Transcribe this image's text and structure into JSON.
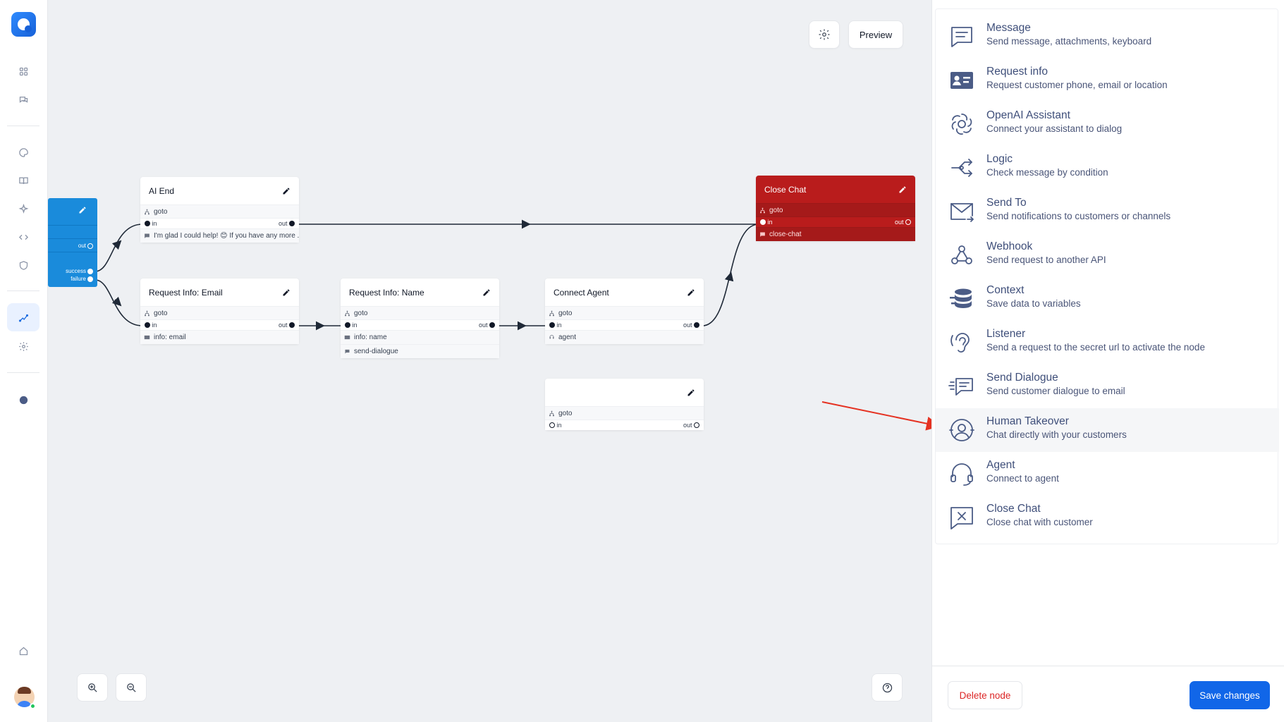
{
  "colors": {
    "accent": "#1166e8",
    "start_node": "#1a8bdb",
    "close_node": "#b91c1c",
    "arrow": "#e53222",
    "delete_text": "#dc2626"
  },
  "sidebar": {
    "icons": [
      "logo-icon",
      "dashboard-icon",
      "chats-icon",
      "palette-icon",
      "book-icon",
      "sparkles-icon",
      "code-icon",
      "shield-icon",
      "flow-icon",
      "gear-icon",
      "chat-bubble-icon",
      "home-icon"
    ],
    "active": "flow-icon"
  },
  "toolbar": {
    "preview_label": "Preview"
  },
  "nodes": {
    "start": {
      "out": "out",
      "success": "success",
      "failure": "failure"
    },
    "ai_end": {
      "title": "AI End",
      "goto": "goto",
      "in": "in",
      "out": "out",
      "detail": "I'm glad I could help! 😊 If you have any more ..."
    },
    "req_email": {
      "title": "Request Info: Email",
      "goto": "goto",
      "in": "in",
      "out": "out",
      "detail": "info: email"
    },
    "req_name": {
      "title": "Request Info: Name",
      "goto": "goto",
      "in": "in",
      "out": "out",
      "detail": "info: name",
      "detail2": "send-dialogue"
    },
    "connect_agent": {
      "title": "Connect Agent",
      "goto": "goto",
      "in": "in",
      "out": "out",
      "detail": "agent"
    },
    "empty_node": {
      "title": "",
      "goto": "goto",
      "in": "in",
      "out": "out"
    },
    "close_chat": {
      "title": "Close Chat",
      "goto": "goto",
      "in": "in",
      "out": "out",
      "detail": "close-chat"
    }
  },
  "panel": {
    "items": [
      {
        "title": "Message",
        "desc": "Send message, attachments, keyboard",
        "icon": "message-icon"
      },
      {
        "title": "Request info",
        "desc": "Request customer phone, email or location",
        "icon": "contact-card-icon"
      },
      {
        "title": "OpenAI Assistant",
        "desc": "Connect your assistant to dialog",
        "icon": "openai-icon"
      },
      {
        "title": "Logic",
        "desc": "Check message by condition",
        "icon": "logic-icon"
      },
      {
        "title": "Send To",
        "desc": "Send notifications to customers or channels",
        "icon": "mail-icon"
      },
      {
        "title": "Webhook",
        "desc": "Send request to another API",
        "icon": "webhook-icon"
      },
      {
        "title": "Context",
        "desc": "Save data to variables",
        "icon": "database-icon"
      },
      {
        "title": "Listener",
        "desc": "Send a request to the secret url to activate the node",
        "icon": "ear-icon"
      },
      {
        "title": "Send Dialogue",
        "desc": "Send customer dialogue to email",
        "icon": "send-dialogue-icon"
      },
      {
        "title": "Human Takeover",
        "desc": "Chat directly with your customers",
        "icon": "user-circle-icon"
      },
      {
        "title": "Agent",
        "desc": "Connect to agent",
        "icon": "headset-icon"
      },
      {
        "title": "Close Chat",
        "desc": "Close chat with customer",
        "icon": "close-chat-icon"
      }
    ],
    "highlighted": "Human Takeover",
    "delete_label": "Delete node",
    "save_label": "Save changes"
  }
}
